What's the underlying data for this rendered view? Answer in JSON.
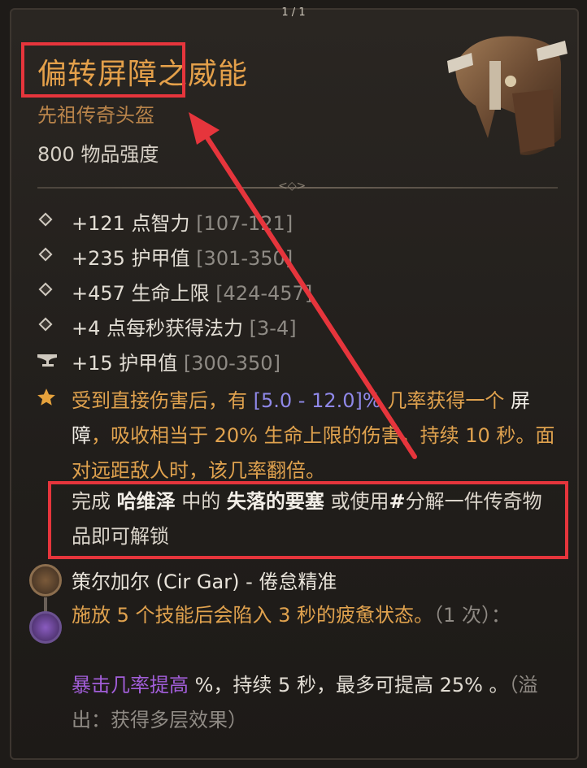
{
  "pager": "1 / 1",
  "item": {
    "name": "偏转屏障之威能",
    "type": "先祖传奇头盔",
    "power": "800 物品强度"
  },
  "stats": [
    {
      "text": "+121 点智力",
      "range": "[107-121]",
      "icon": "diamond-bullet"
    },
    {
      "text": "+235 护甲值",
      "range": "[301-350]",
      "icon": "diamond-bullet"
    },
    {
      "text": "+457 生命上限",
      "range": "[424-457]",
      "icon": "diamond-bullet"
    },
    {
      "text": "+4 点每秒获得法力",
      "range": "[3-4]",
      "icon": "diamond-bullet"
    },
    {
      "text": "+15 护甲值",
      "range": "[300-350]",
      "icon": "anvil-icon"
    }
  ],
  "legendary": {
    "icon": "star-icon",
    "p1": "受到直接伤害后，有 ",
    "range": "[5.0 - 12.0]%",
    "p2": " 几率获得一个 ",
    "barrier": "屏障",
    "p3": "，吸收相当于 20% 生命上限的伤害，持续 10 秒。面对远距敌人时，该几率翻倍。"
  },
  "unlock": {
    "p1": "完成 ",
    "npc": "哈维泽",
    "p2": " 中的 ",
    "quest": "失落的要塞",
    "p3": " 或使用",
    "hash": "#",
    "p4": "分解一件传奇物品即可解锁"
  },
  "rune": {
    "name": "策尔加尔 (Cir Gar) - 倦怠精准",
    "desc": "施放 5 个技能后会陷入 3 秒的疲惫状态。",
    "desc_gray": "（1 次）：",
    "eff_purple": "暴击几率提高",
    "eff1": " %，持续 5 秒，最多可提高 25% 。",
    "eff_gray": "（溢出：获得多层效果）"
  },
  "colors": {
    "title": "#e4a04a",
    "legendary_text": "#e0a24e",
    "range_purple": "#8f88e8",
    "annotation_red": "#e6353c"
  }
}
